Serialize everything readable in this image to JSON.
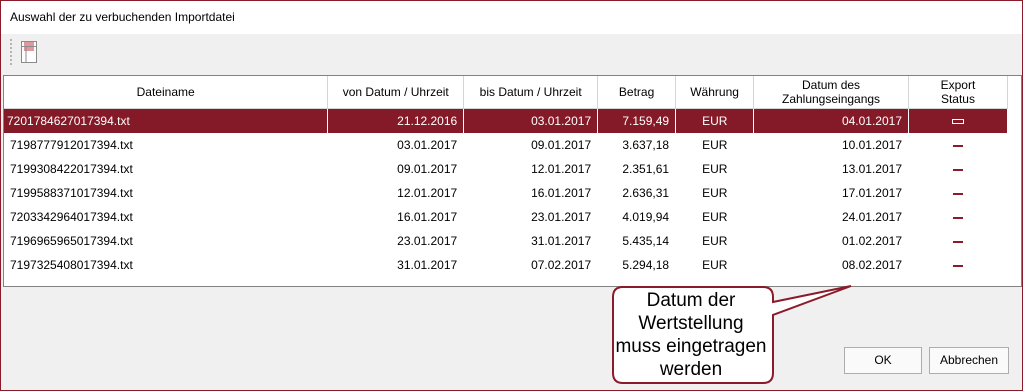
{
  "window": {
    "title": "Auswahl der zu verbuchenden Importdatei"
  },
  "toolbar": {
    "icon": "document-list-icon"
  },
  "table": {
    "headers": {
      "dateiname": "Dateiname",
      "von": "von Datum / Uhrzeit",
      "bis": "bis Datum / Uhrzeit",
      "betrag": "Betrag",
      "waehrung": "Währung",
      "zahlung_line1": "Datum des",
      "zahlung_line2": "Zahlungseingangs",
      "export_line1": "Export",
      "export_line2": "Status"
    },
    "rows": [
      {
        "file": "7201784627017394.txt",
        "from": "21.12.2016",
        "to": "03.01.2017",
        "amount": "7.159,49",
        "currency": "EUR",
        "payment": "04.01.2017",
        "selected": true
      },
      {
        "file": "7198777912017394.txt",
        "from": "03.01.2017",
        "to": "09.01.2017",
        "amount": "3.637,18",
        "currency": "EUR",
        "payment": "10.01.2017",
        "selected": false
      },
      {
        "file": "7199308422017394.txt",
        "from": "09.01.2017",
        "to": "12.01.2017",
        "amount": "2.351,61",
        "currency": "EUR",
        "payment": "13.01.2017",
        "selected": false
      },
      {
        "file": "7199588371017394.txt",
        "from": "12.01.2017",
        "to": "16.01.2017",
        "amount": "2.636,31",
        "currency": "EUR",
        "payment": "17.01.2017",
        "selected": false
      },
      {
        "file": "7203342964017394.txt",
        "from": "16.01.2017",
        "to": "23.01.2017",
        "amount": "4.019,94",
        "currency": "EUR",
        "payment": "24.01.2017",
        "selected": false
      },
      {
        "file": "7196965965017394.txt",
        "from": "23.01.2017",
        "to": "31.01.2017",
        "amount": "5.435,14",
        "currency": "EUR",
        "payment": "01.02.2017",
        "selected": false
      },
      {
        "file": "7197325408017394.txt",
        "from": "31.01.2017",
        "to": "07.02.2017",
        "amount": "5.294,18",
        "currency": "EUR",
        "payment": "08.02.2017",
        "selected": false
      }
    ]
  },
  "callout": {
    "line1": "Datum der",
    "line2": "Wertstellung",
    "line3": "muss eingetragen",
    "line4": "werden"
  },
  "buttons": {
    "ok": "OK",
    "cancel": "Abbrechen"
  },
  "colors": {
    "accent": "#841a27",
    "border": "#8b1a2a"
  }
}
